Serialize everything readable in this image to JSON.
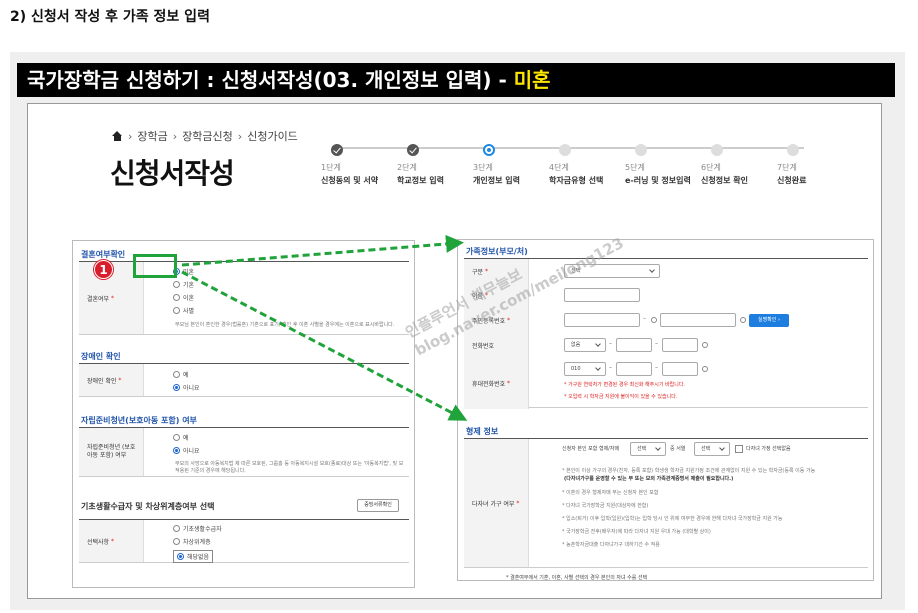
{
  "page_heading": "2) 신청서 작성 후 가족 정보 입력",
  "banner": {
    "prefix": "국가장학금 신청하기 : 신청서작성(03. 개인정보 입력) - ",
    "highlight": "미혼"
  },
  "breadcrumb": [
    "장학금",
    "장학금신청",
    "신청가이드"
  ],
  "page_title": "신청서작성",
  "steps": [
    {
      "num": "1단계",
      "name": "신청동의 및 서약"
    },
    {
      "num": "2단계",
      "name": "학교정보 입력"
    },
    {
      "num": "3단계",
      "name": "개인정보 입력"
    },
    {
      "num": "4단계",
      "name": "학자금유형 선택"
    },
    {
      "num": "5단계",
      "name": "e-러닝 및 정보입력"
    },
    {
      "num": "6단계",
      "name": "신청정보 확인"
    },
    {
      "num": "7단계",
      "name": "신청완료"
    }
  ],
  "marital": {
    "section_title": "결혼여부확인",
    "label": "결혼여부",
    "options": [
      "미혼",
      "기혼",
      "이혼",
      "사별"
    ],
    "note": "부모님 본인이 혼인한 경우(법률혼) 기혼으로 표기, 혼인 후 이혼 사별을 경우에는 이혼으로 표시바랍니다."
  },
  "disability": {
    "section_title": "장애인 확인",
    "label": "장애인 확인",
    "options": [
      "예",
      "아니요"
    ]
  },
  "protected": {
    "section_title": "자립준비청년(보호아동 포함) 여부",
    "label": "자립준비청년 (보호아동 포함) 여부",
    "options": [
      "예",
      "아니요"
    ],
    "note1": "부모의 사망으로 아동복지법 제 따른 보호된, 그룹홈 등 아동복지시설 보호(종료)대상 또는 '아동복지법', 및 보건복지부령에서",
    "note2": "적용된 기준의 경우에 해당됩니다."
  },
  "basic_living": {
    "section_title": "기초생활수급자 및 차상위계층여부 선택",
    "button": "증빙서류확인",
    "label": "선택사항",
    "options": [
      "기초생활수급자",
      "차상위계층",
      "해당없음"
    ]
  },
  "family": {
    "section_title": "가족정보(부모/처)",
    "relation_label": "구분",
    "relation_value": "선택",
    "name_label": "이름",
    "rrn_label": "주민등록번호",
    "verify_button": "실명확인",
    "phone_label": "전화번호",
    "phone_prefix": "없음",
    "mobile_label": "휴대전화번호",
    "mobile_prefix": "010",
    "warn1": "* 가구원 연락처가 변경된 경우 최신화 해주시기 바랍니다.",
    "warn2": "* 오입력 시 학자금 지원에 불이익이 있을 수 있습니다."
  },
  "extra": {
    "section_title": "형제 정보",
    "label": "다자녀 가구 여부",
    "line1_prefix": "신청자 본인 포함 형제/자매",
    "line1_select1": "선택",
    "line1_mid": "중 서열",
    "line1_select2": "선택",
    "line1_check": "다자녀 가정 선택없음",
    "bullets": [
      "* 본인이 이상 가구의 경우(친자, 등록 포함) 학생생 학자금 지원가정 조건에 관계없이 지원 수 있는 학자금(등록 이동 가능",
      "(다자녀가구를 운영할 수 있는 부 또는 모의 가족관계증명서 제출이 필요합니다.)",
      "* 이혼의 경우 형제자매 부는 신청자 본인 포함",
      "* 다자녀 국가장학금 지원(대상자에 한함)",
      "* 입소(퇴거) 이후 입학(입원)(입학)는 입학 당시 인 위에 여부한 경우에 한해 다자녀 국가장학금 지원 가능",
      "* 국가장학금 전후(배우자)에 따라 다자녀 지원 우대 가능 (대학별 상이)",
      "* 농촌학자금대출 다자녀가구 대하기간 수 적용"
    ],
    "footer": "* 결혼여부에서 기혼, 이혼, 사별 선택의 경우 본인의 자녀 수를 선택"
  },
  "badge_number": "1",
  "watermark": [
    "인플루언서 해무늘보",
    "blog.naver.com/meilong123"
  ],
  "colors": {
    "highlight_box": "#1fa33a",
    "arrow": "#1fa33a",
    "badge": "#d81e2c",
    "banner_accent": "#ffe600",
    "link_blue": "#2255aa"
  }
}
